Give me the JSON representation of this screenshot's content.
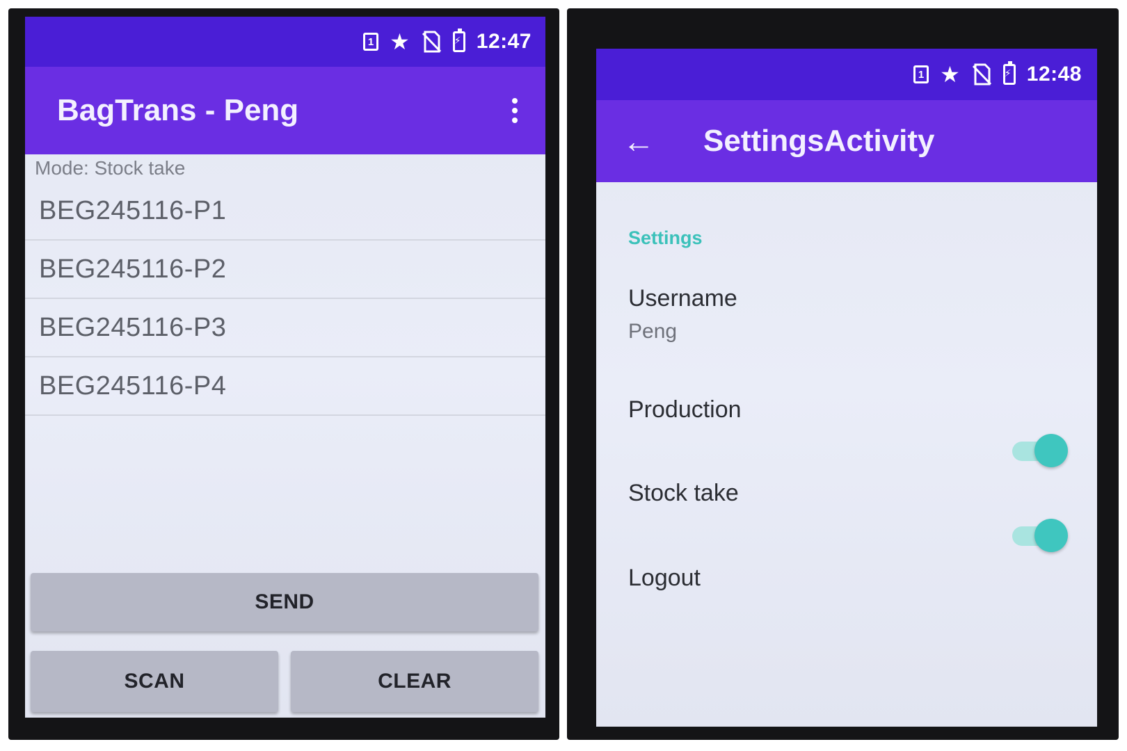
{
  "main_screen": {
    "status_bar": {
      "time": "12:47",
      "sim_label": "1",
      "icons": [
        "sim-icon",
        "star-icon",
        "no-sim-icon",
        "battery-charging-icon"
      ]
    },
    "app_bar": {
      "title": "BagTrans - Peng",
      "menu_icon": "overflow-menu-icon"
    },
    "mode_label": "Mode: Stock take",
    "items": [
      "BEG245116-P1",
      "BEG245116-P2",
      "BEG245116-P3",
      "BEG245116-P4"
    ],
    "buttons": {
      "send": "SEND",
      "scan": "SCAN",
      "clear": "CLEAR"
    }
  },
  "settings_screen": {
    "status_bar": {
      "time": "12:48",
      "sim_label": "1",
      "icons": [
        "sim-icon",
        "star-icon",
        "no-sim-icon",
        "battery-charging-icon"
      ]
    },
    "app_bar": {
      "title": "SettingsActivity",
      "back_icon": "back-arrow-icon"
    },
    "category": "Settings",
    "username": {
      "title": "Username",
      "value": "Peng"
    },
    "production": {
      "title": "Production",
      "enabled": true
    },
    "stock_take": {
      "title": "Stock take",
      "enabled": true
    },
    "logout": {
      "title": "Logout"
    }
  },
  "colors": {
    "status_bar": "#4a1ed6",
    "app_bar": "#6a2ee3",
    "accent": "#3fc6bf",
    "button": "#b6b8c6"
  }
}
